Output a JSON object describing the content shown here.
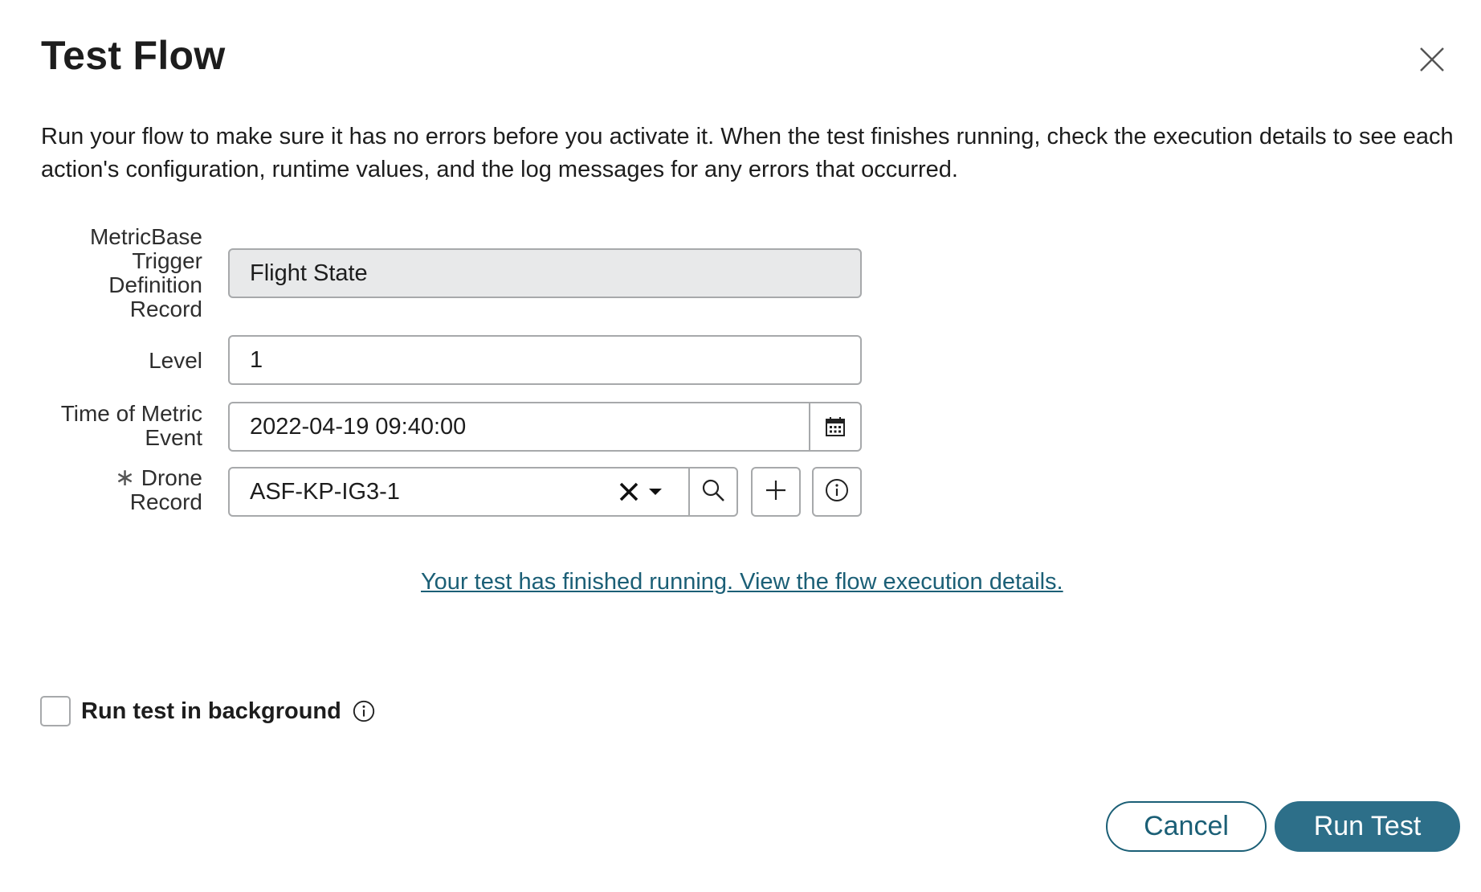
{
  "dialog": {
    "title": "Test Flow",
    "description": "Run your flow to make sure it has no errors before you activate it. When the test finishes running, check the execution details to see each action's configuration, runtime values, and the log messages for any errors that occurred."
  },
  "fields": {
    "trigger_label_lines": [
      "MetricBase",
      "Trigger",
      "Definition",
      "Record"
    ],
    "trigger_value": "Flight State",
    "level_label": "Level",
    "level_value": "1",
    "time_label_lines": [
      "Time of Metric",
      "Event"
    ],
    "time_value": "2022-04-19 09:40:00",
    "drone_required_mark": "∗",
    "drone_label_lines": [
      "Drone",
      "Record"
    ],
    "drone_value": "ASF-KP-IG3-1"
  },
  "result_link": "Your test has finished running. View the flow execution details.",
  "background": {
    "label": "Run test in background",
    "checked": false
  },
  "buttons": {
    "cancel": "Cancel",
    "run": "Run Test"
  },
  "colors": {
    "accent": "#1b5f76",
    "primary_button": "#2d6f89",
    "readonly_bg": "#e8e9ea",
    "border": "#a7a9ab"
  }
}
